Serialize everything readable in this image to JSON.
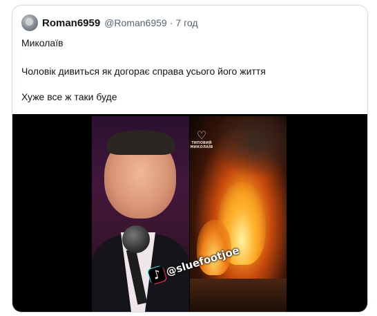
{
  "tweet": {
    "author_name": "Roman6959",
    "author_handle": "@Roman6959",
    "separator": "·",
    "time_ago": "7 год",
    "text_lines": [
      "Миколаїв",
      "Чоловік дивиться як догорає справа усього його життя",
      "Хуже все ж таки буде"
    ]
  },
  "media": {
    "channel_logo_text": "ТИПОВИЙ МИКОЛАЇВ",
    "watermark": "@sluefootjoe",
    "tiktok_icon": "tiktok-icon"
  },
  "colors": {
    "border": "#cfd9de",
    "secondary_text": "#536471",
    "primary_text": "#0f1419"
  }
}
